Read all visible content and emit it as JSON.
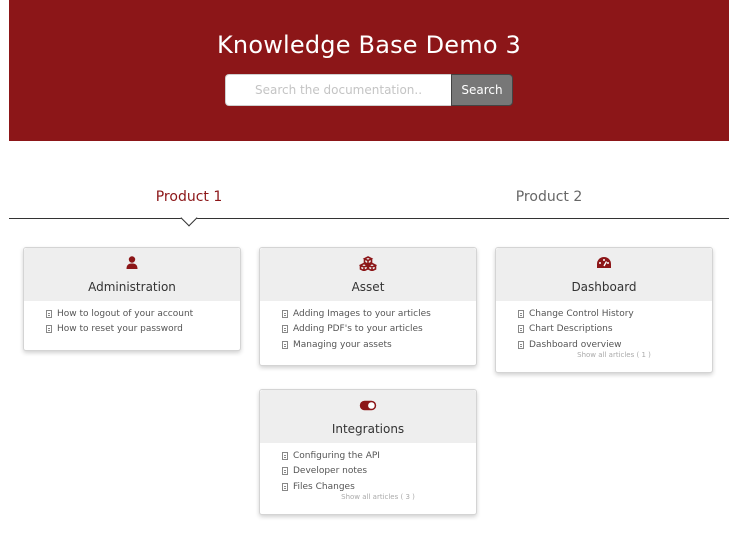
{
  "header": {
    "title": "Knowledge Base Demo 3",
    "search_placeholder": "Search the documentation..",
    "search_button": "Search"
  },
  "tabs": [
    {
      "label": "Product 1",
      "active": true
    },
    {
      "label": "Product 2",
      "active": false
    }
  ],
  "colors": {
    "brand": "#8c1618",
    "search_button": "#777777"
  },
  "categories": [
    {
      "title": "Administration",
      "icon": "user-icon",
      "articles": [
        "How to logout of your account",
        "How to reset your password"
      ],
      "show_all": ""
    },
    {
      "title": "Asset",
      "icon": "cubes-icon",
      "articles": [
        "Adding Images to your articles",
        "Adding PDF's to your articles",
        "Managing your assets"
      ],
      "show_all": ""
    },
    {
      "title": "Dashboard",
      "icon": "dashboard-icon",
      "articles": [
        "Change Control History",
        "Chart Descriptions",
        "Dashboard overview"
      ],
      "show_all": "Show all articles ( 1 )"
    },
    {
      "title": "Integrations",
      "icon": "toggle-icon",
      "articles": [
        "Configuring the API",
        "Developer notes",
        "Files Changes"
      ],
      "show_all": "Show all articles ( 3 )"
    }
  ]
}
